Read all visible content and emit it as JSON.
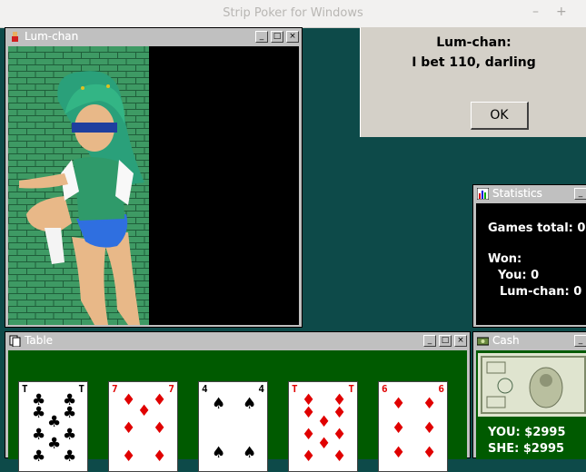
{
  "app": {
    "title": "Strip Poker for Windows",
    "minimize": "–",
    "maximize": "+"
  },
  "lum_window": {
    "title": "Lum-chan"
  },
  "message": {
    "line1": "Lum-chan:",
    "line2": "I bet 110, darling",
    "ok_label": "OK"
  },
  "stats": {
    "title": "Statistics",
    "games_total": "Games total: 0",
    "won": "Won:",
    "you": "You: 0",
    "opponent": "Lum-chan: 0"
  },
  "table": {
    "title": "Table",
    "cards": [
      {
        "rank": "T",
        "suit": "♣",
        "color": "#000000"
      },
      {
        "rank": "7",
        "suit": "♦",
        "color": "#e00000"
      },
      {
        "rank": "4",
        "suit": "♠",
        "color": "#000000"
      },
      {
        "rank": "T",
        "suit": "♦",
        "color": "#e00000"
      },
      {
        "rank": "6",
        "suit": "♦",
        "color": "#e00000"
      }
    ]
  },
  "cash": {
    "title": "Cash",
    "you": "YOU: $2995",
    "she": "SHE: $2995"
  },
  "colors": {
    "felt": "#0d4a49",
    "table_green": "#005a00"
  }
}
